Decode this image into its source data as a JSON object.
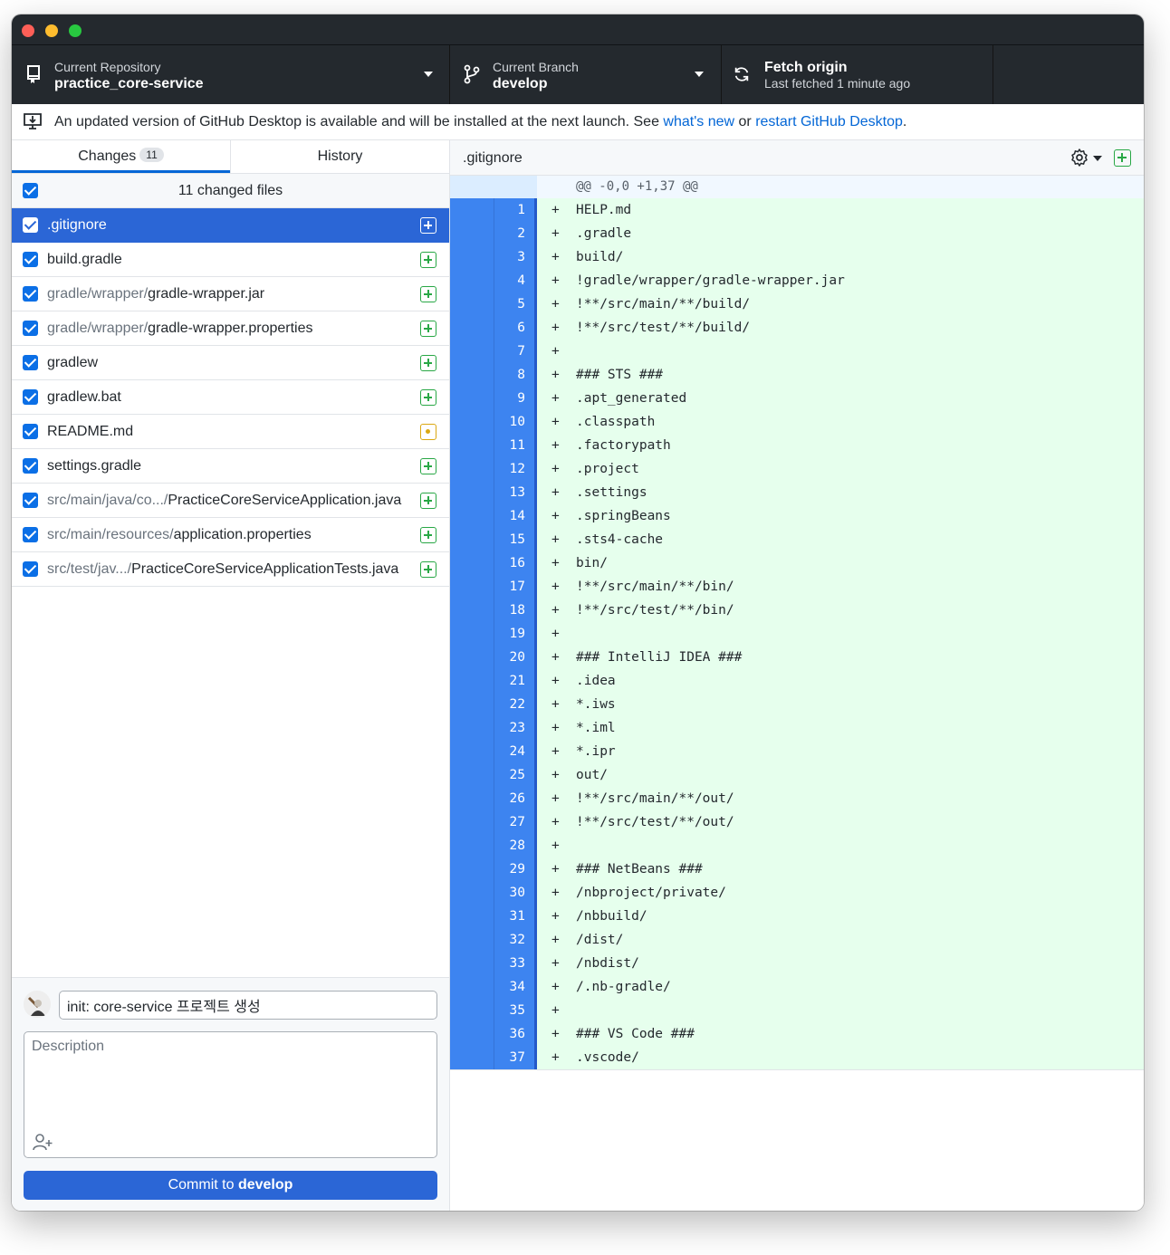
{
  "toolbar": {
    "repo_label": "Current Repository",
    "repo_name": "practice_core-service",
    "branch_label": "Current Branch",
    "branch_name": "develop",
    "fetch_title": "Fetch origin",
    "fetch_sub": "Last fetched 1 minute ago"
  },
  "banner": {
    "text": "An updated version of GitHub Desktop is available and will be installed at the next launch. See ",
    "link1": "what's new",
    "mid": " or ",
    "link2": "restart GitHub Desktop",
    "end": "."
  },
  "tabs": {
    "changes": "Changes",
    "changes_count": "11",
    "history": "History"
  },
  "changes": {
    "header": "11 changed files",
    "files": [
      {
        "dir": "",
        "name": ".gitignore",
        "status": "added",
        "selected": true
      },
      {
        "dir": "",
        "name": "build.gradle",
        "status": "added"
      },
      {
        "dir": "gradle/wrapper/",
        "name": "gradle-wrapper.jar",
        "status": "added"
      },
      {
        "dir": "gradle/wrapper/",
        "name": "gradle-wrapper.properties",
        "status": "added"
      },
      {
        "dir": "",
        "name": "gradlew",
        "status": "added"
      },
      {
        "dir": "",
        "name": "gradlew.bat",
        "status": "added"
      },
      {
        "dir": "",
        "name": "README.md",
        "status": "modified"
      },
      {
        "dir": "",
        "name": "settings.gradle",
        "status": "added"
      },
      {
        "dir": "src/main/java/co.../",
        "name": "PracticeCoreServiceApplication.java",
        "status": "added"
      },
      {
        "dir": "src/main/resources/",
        "name": "application.properties",
        "status": "added"
      },
      {
        "dir": "src/test/jav.../",
        "name": "PracticeCoreServiceApplicationTests.java",
        "status": "added"
      }
    ]
  },
  "commit": {
    "summary": "init: core-service 프로젝트 생성",
    "description_placeholder": "Description",
    "button_prefix": "Commit to ",
    "button_branch": "develop"
  },
  "diff": {
    "filename": ".gitignore",
    "hunk": "@@ -0,0 +1,37 @@",
    "lines": [
      "HELP.md",
      ".gradle",
      "build/",
      "!gradle/wrapper/gradle-wrapper.jar",
      "!**/src/main/**/build/",
      "!**/src/test/**/build/",
      "",
      "### STS ###",
      ".apt_generated",
      ".classpath",
      ".factorypath",
      ".project",
      ".settings",
      ".springBeans",
      ".sts4-cache",
      "bin/",
      "!**/src/main/**/bin/",
      "!**/src/test/**/bin/",
      "",
      "### IntelliJ IDEA ###",
      ".idea",
      "*.iws",
      "*.iml",
      "*.ipr",
      "out/",
      "!**/src/main/**/out/",
      "!**/src/test/**/out/",
      "",
      "### NetBeans ###",
      "/nbproject/private/",
      "/nbbuild/",
      "/dist/",
      "/nbdist/",
      "/.nb-gradle/",
      "",
      "### VS Code ###",
      ".vscode/"
    ]
  },
  "icons": {
    "repo": "repo-icon",
    "branch": "git-branch-icon",
    "fetch": "sync-icon",
    "banner": "desktop-download-icon",
    "settings": "gear-icon",
    "coauthor": "person-add-icon"
  },
  "colors": {
    "accent": "#2b66d6",
    "added": "#28a745",
    "modified": "#dba812",
    "diff_added_bg": "#e6ffed",
    "toolbar_bg": "#24292e"
  }
}
